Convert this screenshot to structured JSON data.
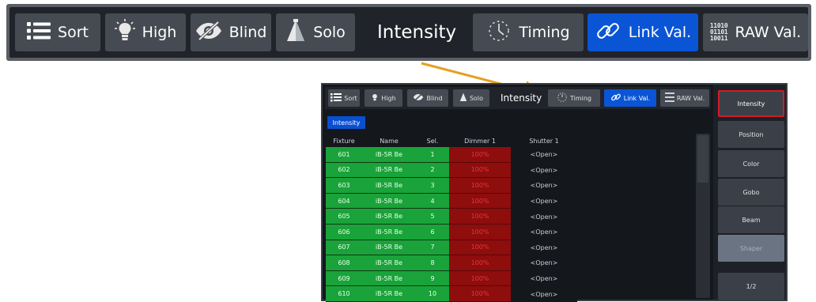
{
  "big_toolbar": {
    "sort": "Sort",
    "high": "High",
    "blind": "Blind",
    "solo": "Solo",
    "title": "Intensity",
    "timing": "Timing",
    "link": "Link Val.",
    "raw": "RAW Val.",
    "raw_glyph": [
      "11010",
      "01101",
      "10011"
    ]
  },
  "small_toolbar": {
    "sort": "Sort",
    "high": "High",
    "blind": "Blind",
    "solo": "Solo",
    "title": "Intensity",
    "timing": "Timing",
    "link": "Link Val.",
    "raw": "RAW Val."
  },
  "filter_tag": "Intensity",
  "columns": [
    "Fixture",
    "Name",
    "Sel.",
    "Dimmer 1",
    "Shutter 1"
  ],
  "rows": [
    {
      "fixture": "601",
      "name": "iB-5R Be",
      "sel": "1",
      "dimmer": "100%",
      "shutter": "<Open>"
    },
    {
      "fixture": "602",
      "name": "iB-5R Be",
      "sel": "2",
      "dimmer": "100%",
      "shutter": "<Open>"
    },
    {
      "fixture": "603",
      "name": "iB-5R Be",
      "sel": "3",
      "dimmer": "100%",
      "shutter": "<Open>"
    },
    {
      "fixture": "604",
      "name": "iB-5R Be",
      "sel": "4",
      "dimmer": "100%",
      "shutter": "<Open>"
    },
    {
      "fixture": "605",
      "name": "iB-5R Be",
      "sel": "5",
      "dimmer": "100%",
      "shutter": "<Open>"
    },
    {
      "fixture": "606",
      "name": "iB-5R Be",
      "sel": "6",
      "dimmer": "100%",
      "shutter": "<Open>"
    },
    {
      "fixture": "607",
      "name": "iB-5R Be",
      "sel": "7",
      "dimmer": "100%",
      "shutter": "<Open>"
    },
    {
      "fixture": "608",
      "name": "iB-5R Be",
      "sel": "8",
      "dimmer": "100%",
      "shutter": "<Open>"
    },
    {
      "fixture": "609",
      "name": "iB-5R Be",
      "sel": "9",
      "dimmer": "100%",
      "shutter": "<Open>"
    },
    {
      "fixture": "610",
      "name": "iB-5R Be",
      "sel": "10",
      "dimmer": "100%",
      "shutter": "<Open>"
    }
  ],
  "side_buttons": [
    {
      "label": "Intensity",
      "state": "selected"
    },
    {
      "label": "Position",
      "state": "normal"
    },
    {
      "label": "Color",
      "state": "normal"
    },
    {
      "label": "Gobo",
      "state": "normal"
    },
    {
      "label": "Beam",
      "state": "normal"
    },
    {
      "label": "Shaper",
      "state": "disabled"
    },
    {
      "label": "1/2",
      "state": "normal"
    }
  ],
  "colors": {
    "active_blue": "#0a55d6",
    "selected_green": "#19a33a",
    "dimmer_red": "#8e0d0d",
    "arrow_orange": "#e6a020",
    "selected_outline": "#d11a2a"
  }
}
